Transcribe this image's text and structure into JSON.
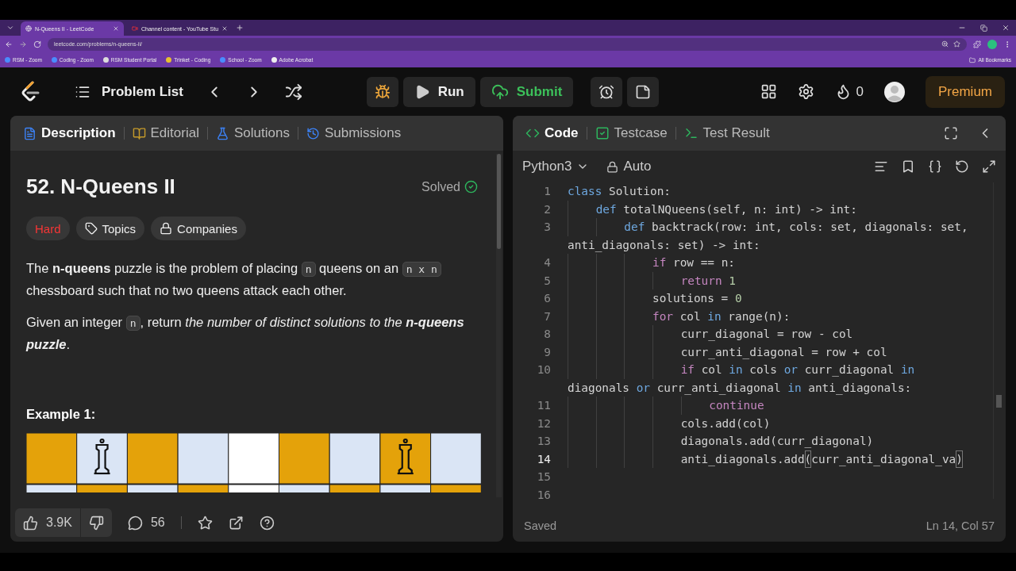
{
  "browser": {
    "tabs": [
      {
        "title": "N-Queens II - LeetCode",
        "selected": true
      },
      {
        "title": "Channel content - YouTube Stu",
        "selected": false
      }
    ],
    "address": "leetcode.com/problems/n-queens-ii/",
    "bookmarks": [
      "RSM - Zoom",
      "Coding - Zoom",
      "RSM Student Portal",
      "Trinket - Coding",
      "School - Zoom",
      "Adobe Acrobat"
    ],
    "all_bookmarks": "All Bookmarks"
  },
  "nav": {
    "problem_list": "Problem List",
    "run": "Run",
    "submit": "Submit",
    "streak": "0",
    "premium": "Premium"
  },
  "left_panel": {
    "tabs": [
      {
        "label": "Description",
        "selected": true
      },
      {
        "label": "Editorial",
        "selected": false
      },
      {
        "label": "Solutions",
        "selected": false
      },
      {
        "label": "Submissions",
        "selected": false
      }
    ],
    "title": "52. N-Queens II",
    "status": "Solved",
    "tags": [
      {
        "label": "Hard",
        "kind": "difficulty"
      },
      {
        "label": "Topics",
        "kind": "topics"
      },
      {
        "label": "Companies",
        "kind": "companies"
      }
    ],
    "paragraphs": [
      {
        "segments": [
          {
            "kind": "plain",
            "text": "The "
          },
          {
            "kind": "bold",
            "text": "n-queens"
          },
          {
            "kind": "plain",
            "text": " puzzle is the problem of placing "
          },
          {
            "kind": "code",
            "text": "n"
          },
          {
            "kind": "plain",
            "text": " queens on an "
          },
          {
            "kind": "code",
            "text": "n x n"
          },
          {
            "kind": "plain",
            "text": " chessboard such that no two queens attack each other."
          }
        ]
      },
      {
        "segments": [
          {
            "kind": "plain",
            "text": "Given an integer "
          },
          {
            "kind": "code",
            "text": "n"
          },
          {
            "kind": "plain",
            "text": ", return "
          },
          {
            "kind": "italic",
            "text": "the number of distinct solutions to the "
          },
          {
            "kind": "bolditalic",
            "text": "n-queens puzzle"
          },
          {
            "kind": "plain",
            "text": "."
          }
        ]
      }
    ],
    "example_heading": "Example 1:",
    "likes": "3.9K",
    "comments": "56"
  },
  "code_panel": {
    "tabs": [
      {
        "label": "Code",
        "selected": true
      },
      {
        "label": "Testcase",
        "selected": false
      },
      {
        "label": "Test Result",
        "selected": false
      }
    ],
    "language": "Python3",
    "mode": "Auto",
    "lines": [
      {
        "number": "1",
        "active": false,
        "text": "class Solution:"
      },
      {
        "number": "2",
        "active": false,
        "text": "    def totalNQueens(self, n: int) -> int:"
      },
      {
        "number": "3",
        "active": false,
        "text": "        def backtrack(row: int, cols: set, diagonals: set,",
        "continuation": "anti_diagonals: set) -> int:"
      },
      {
        "number": "4",
        "active": false,
        "text": "            if row == n:"
      },
      {
        "number": "5",
        "active": false,
        "text": "                return 1"
      },
      {
        "number": "6",
        "active": false,
        "text": "            solutions = 0"
      },
      {
        "number": "7",
        "active": false,
        "text": "            for col in range(n):"
      },
      {
        "number": "8",
        "active": false,
        "text": "                curr_diagonal = row - col"
      },
      {
        "number": "9",
        "active": false,
        "text": "                curr_anti_diagonal = row + col"
      },
      {
        "number": "10",
        "active": false,
        "text": "                if col in cols or curr_diagonal in",
        "continuation": "diagonals or curr_anti_diagonal in anti_diagonals:"
      },
      {
        "number": "11",
        "active": false,
        "text": "                    continue"
      },
      {
        "number": "12",
        "active": false,
        "text": "                cols.add(col)"
      },
      {
        "number": "13",
        "active": false,
        "text": "                diagonals.add(curr_diagonal)"
      },
      {
        "number": "14",
        "active": true,
        "text": "                anti_diagonals.add(curr_anti_diagonal_va)"
      },
      {
        "number": "15",
        "active": false
      },
      {
        "number": "16",
        "active": false
      }
    ],
    "status": "Saved",
    "cursor": "Ln 14, Col 57"
  }
}
